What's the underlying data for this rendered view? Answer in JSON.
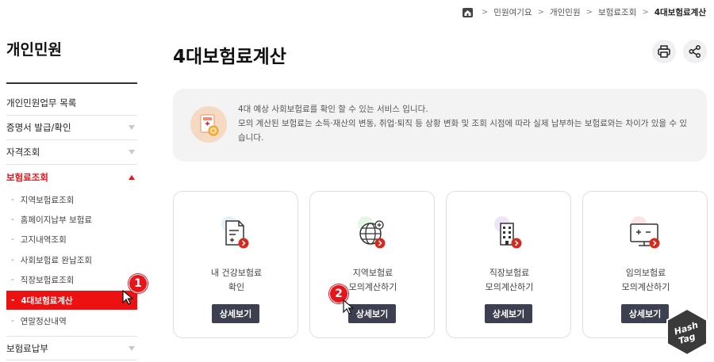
{
  "breadcrumb": {
    "items": [
      "민원여기요",
      "개인민원",
      "보험료조회",
      "4대보험료계산"
    ]
  },
  "sidebar": {
    "title": "개인민원",
    "items": [
      {
        "label": "개인민원업무 목록"
      },
      {
        "label": "증명서 발급/확인"
      },
      {
        "label": "자격조회"
      },
      {
        "label": "보험료조회"
      },
      {
        "label": "보험료납부"
      }
    ],
    "subitems": [
      {
        "label": "지역보험료조회"
      },
      {
        "label": "홈페이지납부 보험료"
      },
      {
        "label": "고지내역조회"
      },
      {
        "label": "사회보험료 완납조회"
      },
      {
        "label": "직장보험료조회"
      },
      {
        "label": "4대보험료계산"
      },
      {
        "label": "연말정산내역"
      }
    ]
  },
  "steps": {
    "one": "1",
    "two": "2"
  },
  "main": {
    "title": "4대보험료계산",
    "info": {
      "line1": "4대 예상 사회보험료를 확인 할 수 있는 서비스 입니다.",
      "line2": "모의 계산된 보험료는 소득·재산의 변동, 취업·퇴직 등 상황 변화 및 조회 시점에 따라 실제 납부하는 보험료와는 차이가 있을 수 있습니다."
    },
    "cards": [
      {
        "line1": "내 건강보험료",
        "line2": "확인",
        "button": "상세보기"
      },
      {
        "line1": "지역보험료",
        "line2": "모의계산하기",
        "button": "상세보기"
      },
      {
        "line1": "직장보험료",
        "line2": "모의계산하기",
        "button": "상세보기"
      },
      {
        "line1": "임의보험료",
        "line2": "모의계산하기",
        "button": "상세보기"
      }
    ]
  },
  "watermark": {
    "line1": "Hash",
    "line2": "Tag"
  },
  "colors": {
    "accent": "#e8141c",
    "button": "#3d4050",
    "info_bg": "#f3f3f4"
  },
  "icons": [
    "home-icon",
    "print-icon",
    "share-icon",
    "document-plus-icon",
    "globe-plus-icon",
    "building-icon",
    "monitor-calc-icon"
  ]
}
